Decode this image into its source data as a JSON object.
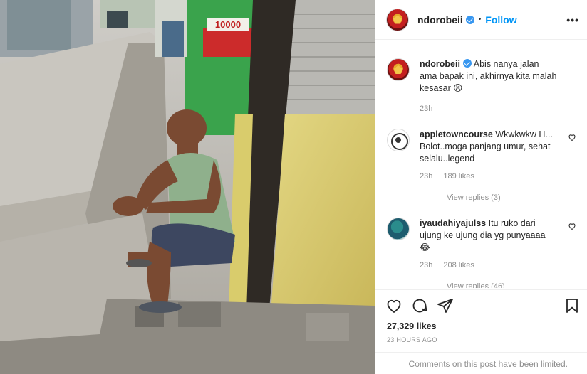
{
  "post": {
    "author": "ndorobeii",
    "follow_label": "Follow",
    "more_label": "•••",
    "caption": "Abis nanya jalan ama bapak ini, akhirnya kita malah kesasar",
    "caption_emoji": "😫",
    "caption_time": "23h",
    "sign_price": "10000"
  },
  "comments": [
    {
      "username": "appletowncourse",
      "text": "Wkwkwkw H... Bolot..moga panjang umur, sehat selalu..legend",
      "time": "23h",
      "likes": "189 likes",
      "view_replies": "View replies (3)"
    },
    {
      "username": "iyaudahiyajulss",
      "text": "Itu ruko dari ujung ke ujung dia yg punyaaaa",
      "emoji": "😂",
      "time": "23h",
      "likes": "208 likes",
      "view_replies": "View replies (46)"
    }
  ],
  "stats": {
    "likes": "27,329 likes",
    "time_ago": "23 HOURS AGO",
    "comments_limited": "Comments on this post have been limited."
  },
  "icons": {
    "like": "heart-icon",
    "comment": "comment-icon",
    "share": "paper-plane-icon",
    "save": "bookmark-icon",
    "verified": "verified-badge-icon",
    "more": "more-options-icon"
  },
  "colors": {
    "accent": "#0095f6",
    "verified": "#3897f0",
    "muted": "#8e8e8e",
    "text": "#262626"
  }
}
